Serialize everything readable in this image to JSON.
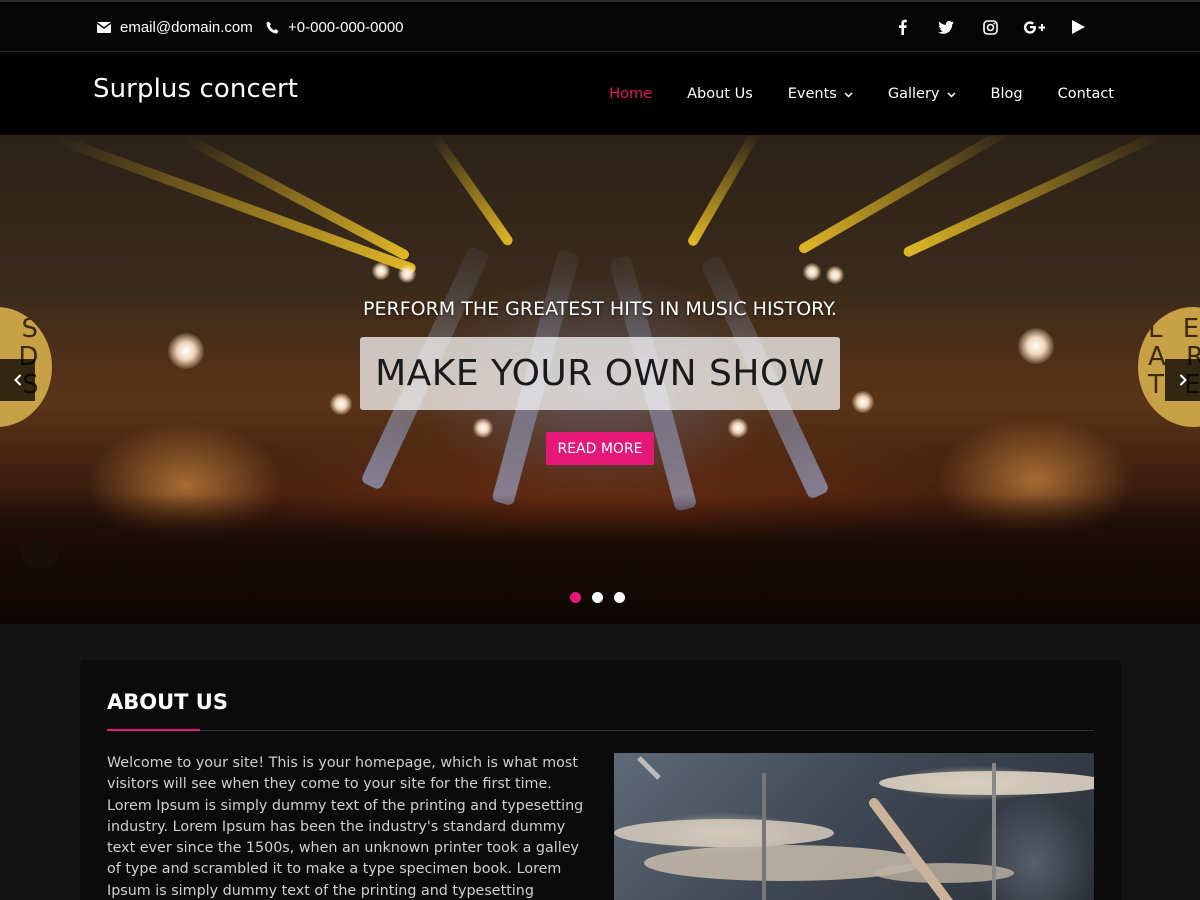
{
  "topbar": {
    "email": "email@domain.com",
    "phone": "+0-000-000-0000",
    "email_icon": "envelope-icon",
    "phone_icon": "phone-icon",
    "social": [
      "facebook-icon",
      "twitter-icon",
      "instagram-icon",
      "google-plus-icon",
      "youtube-icon"
    ]
  },
  "header": {
    "brand": "Surplus concert",
    "nav": [
      {
        "label": "Home",
        "active": true
      },
      {
        "label": "About Us"
      },
      {
        "label": "Events",
        "dropdown": true
      },
      {
        "label": "Gallery",
        "dropdown": true
      },
      {
        "label": "Blog"
      },
      {
        "label": "Contact"
      }
    ]
  },
  "hero": {
    "subtitle": "PERFORM THE GREATEST HITS IN MUSIC HISTORY.",
    "title": "MAKE YOUR OWN SHOW",
    "button": "READ MORE",
    "slides": 3,
    "active_slide": 1,
    "sign_left": "L E S\nA R D E N\nT E S",
    "sign_right": "L E S\nA R D E N\nT E S"
  },
  "about": {
    "title": "ABOUT US",
    "text": "Welcome to your site! This is your homepage, which is what most visitors will see when they come to your site for the first time. Lorem Ipsum is simply dummy text of the printing and typesetting industry. Lorem Ipsum has been the industry's standard dummy text ever since the 1500s, when an unknown printer took a galley of type and scrambled it to make a type specimen book. Lorem Ipsum is simply dummy text of the printing and typesetting industry. Lorem Ipsum has been the industry's standard dummy"
  },
  "colors": {
    "accent": "#e5187a",
    "nav_active": "#e5185e",
    "background": "#141414",
    "topbar": "#050505"
  }
}
